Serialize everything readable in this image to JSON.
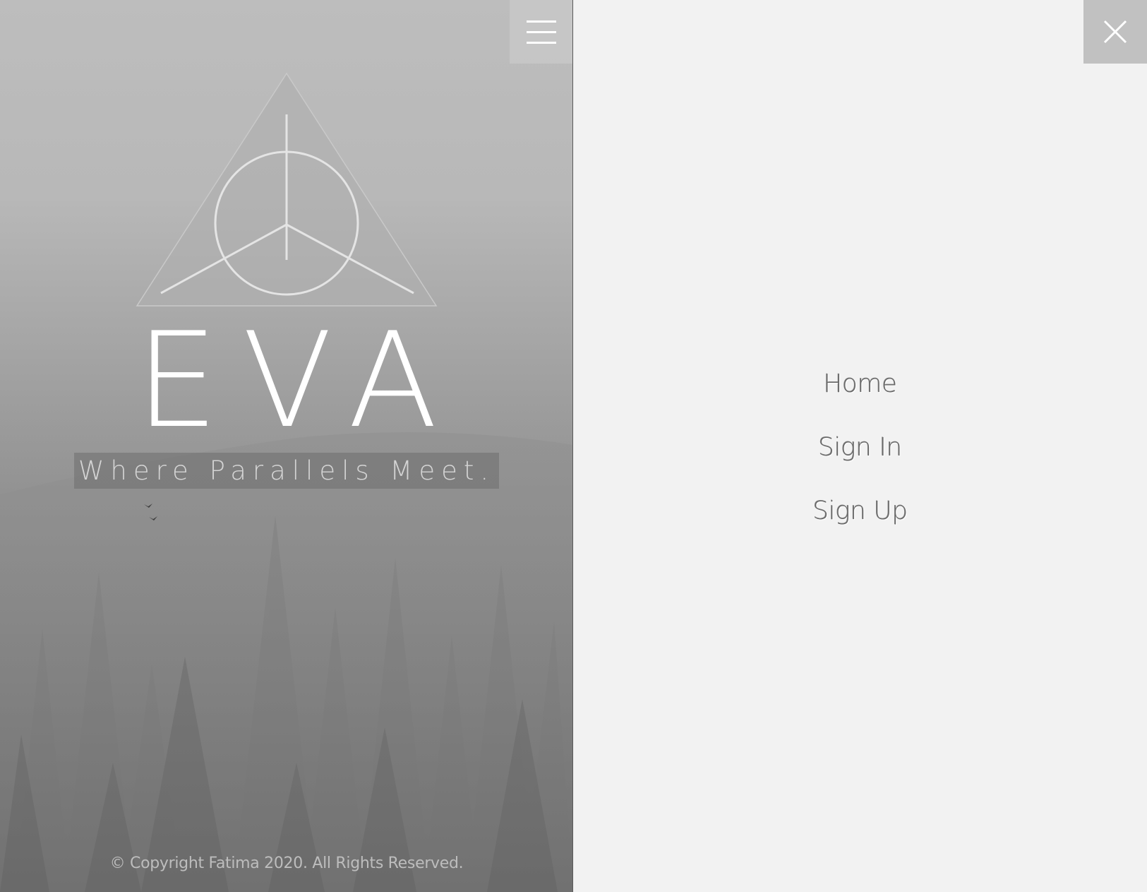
{
  "hero": {
    "brand_name": "EVA",
    "tagline": "Where Parallels Meet.",
    "copyright": "© Copyright Fatima 2020. All Rights Reserved.",
    "menu_icon": "hamburger-icon",
    "logo_icon": "triangle-circle-logo"
  },
  "menu": {
    "close_icon": "close-icon",
    "items": [
      {
        "label": "Home"
      },
      {
        "label": "Sign In"
      },
      {
        "label": "Sign Up"
      }
    ]
  },
  "colors": {
    "menu_background": "#f2f2f2",
    "close_button_background": "#c1c1c1",
    "menu_text": "#6a6a6a",
    "hero_text": "#ffffff"
  }
}
